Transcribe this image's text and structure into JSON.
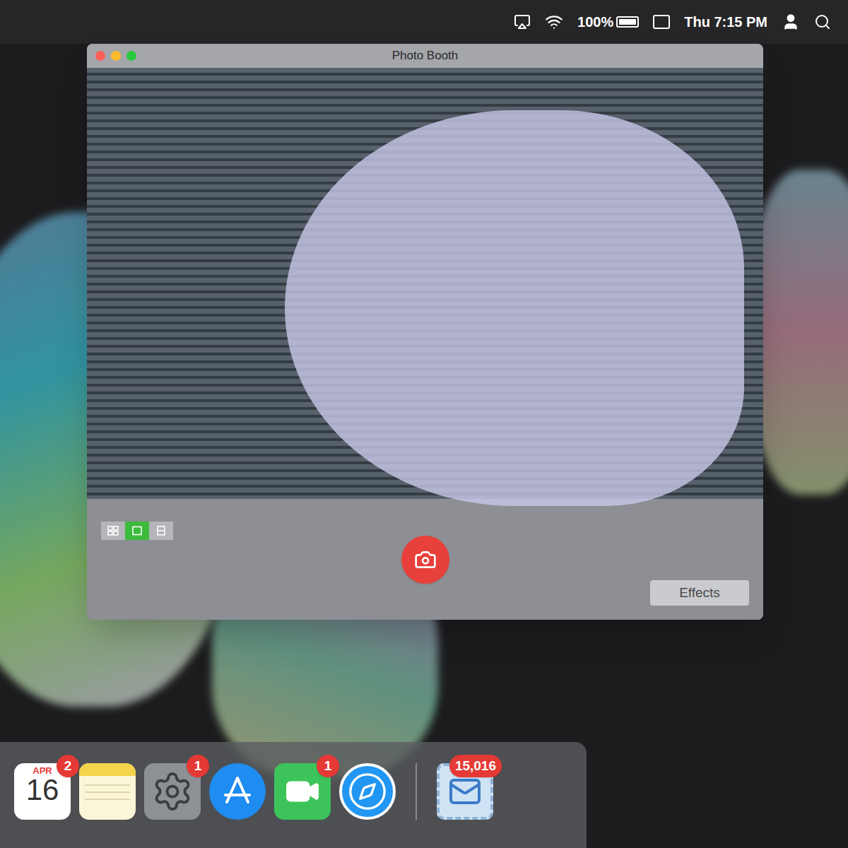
{
  "menu_bar": {
    "battery": "100%",
    "clock": "Thu 7:15 PM"
  },
  "window": {
    "title": "Photo Booth"
  },
  "view_modes": [
    {
      "kind": "grid",
      "selected": false
    },
    {
      "kind": "single",
      "selected": true
    },
    {
      "kind": "strip",
      "selected": false
    }
  ],
  "effects_button": "Effects",
  "dock": [
    {
      "kind": "calendar",
      "month": "APR",
      "day": "16",
      "badge": "2"
    },
    {
      "kind": "notes"
    },
    {
      "kind": "settings",
      "badge": "1"
    },
    {
      "kind": "app-store"
    },
    {
      "kind": "facetime",
      "badge": "1"
    },
    {
      "kind": "safari"
    },
    {
      "kind": "mail",
      "badge": "15,016"
    }
  ]
}
